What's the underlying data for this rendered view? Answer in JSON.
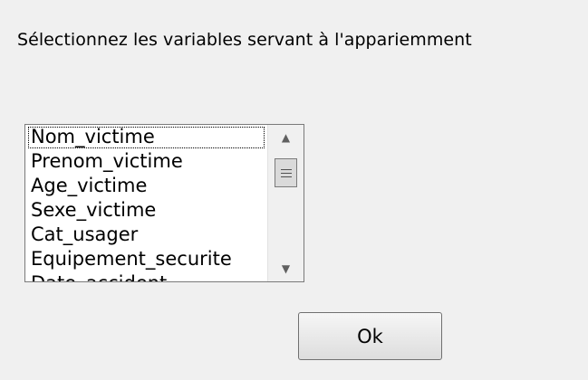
{
  "dialog": {
    "instruction": "Sélectionnez les variables servant à l'appariemment"
  },
  "variables_list": {
    "items": [
      {
        "label": "Nom_victime",
        "focused": true
      },
      {
        "label": "Prenom_victime",
        "focused": false
      },
      {
        "label": "Age_victime",
        "focused": false
      },
      {
        "label": "Sexe_victime",
        "focused": false
      },
      {
        "label": "Cat_usager",
        "focused": false
      },
      {
        "label": "Equipement_securite",
        "focused": false
      },
      {
        "label": "Date_accident",
        "focused": false
      }
    ],
    "scrollbar": {
      "up_icon": "chevron-up-icon",
      "down_icon": "chevron-down-icon",
      "thumb_icon": "grip-icon"
    }
  },
  "buttons": {
    "ok_label": "Ok"
  }
}
